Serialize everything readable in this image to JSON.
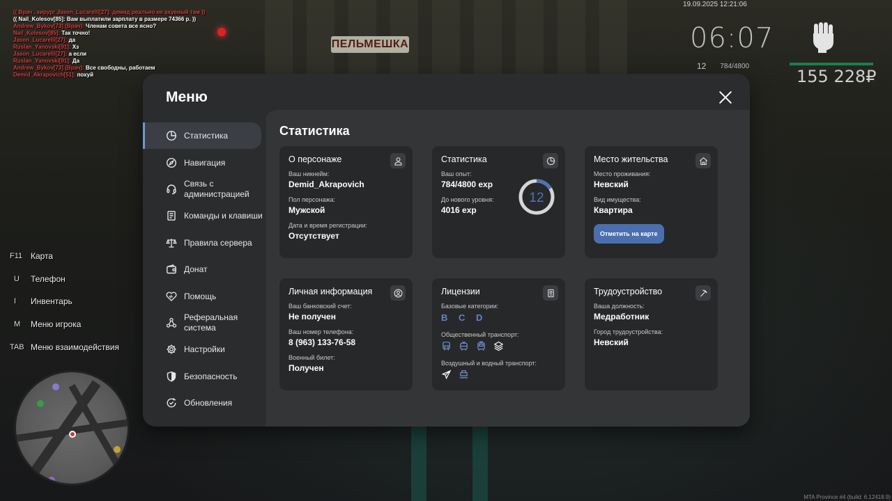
{
  "background": {
    "sign_text": "ПЕЛЬМЕШКА"
  },
  "chat": [
    {
      "text": "(( Врач . хирург Jason_Lucarelli[27]: демид реально не ахуеный там ))",
      "color": "#d93a3a"
    },
    {
      "text": "(( Nail_Kolesov[85]: Вам выплатили зарплату в размере 74366 р. ))",
      "color": "#ffffff"
    },
    {
      "text": "Andrew_Bykov[73] (Врач): Членам совета все ясно?",
      "color": "#ffffff",
      "name_color": "#d93a3a"
    },
    {
      "text": "Nail_Kolesov[85]: Так точно!",
      "color": "#ffffff",
      "name_color": "#d93a3a"
    },
    {
      "text": "Jason_Lucarelli[27]: да",
      "color": "#ffffff",
      "name_color": "#d93a3a"
    },
    {
      "text": "Ruslan_Yanovski[91]: Хз",
      "color": "#ffffff",
      "name_color": "#d93a3a"
    },
    {
      "text": "Jason_Lucarelli[27]: а если",
      "color": "#ffffff",
      "name_color": "#d93a3a"
    },
    {
      "text": "Ruslan_Yanovski[91]: Да",
      "color": "#ffffff",
      "name_color": "#d93a3a"
    },
    {
      "text": "Andrew_Bykov[73] (Врач): Все свободны, работаем",
      "color": "#ffffff",
      "name_color": "#d93a3a"
    },
    {
      "text": "Demid_Akrapovich[51]: похуй",
      "color": "#ffffff",
      "name_color": "#d93a3a"
    }
  ],
  "hud": {
    "datetime": "19.09.2025 12:21:06",
    "time": "06:07",
    "level": "12",
    "exp": "784/4800",
    "money": "155 228₽",
    "bar_color": "#1f7d4c"
  },
  "hotkeys": [
    {
      "key": "F11",
      "label": "Карта"
    },
    {
      "key": "U",
      "label": "Телефон"
    },
    {
      "key": "I",
      "label": "Инвентарь"
    },
    {
      "key": "M",
      "label": "Меню игрока"
    },
    {
      "key": "TAB",
      "label": "Меню взаимодействия"
    }
  ],
  "version": "MTA Province #4 (build: 6.12418.9)",
  "menu": {
    "title": "Меню",
    "sidebar": [
      {
        "label": "Статистика",
        "icon": "pie-chart-icon",
        "active": true
      },
      {
        "label": "Навигация",
        "icon": "compass-icon"
      },
      {
        "label": "Связь с администрацией",
        "icon": "headset-icon"
      },
      {
        "label": "Команды и клавиши",
        "icon": "document-icon"
      },
      {
        "label": "Правила сервера",
        "icon": "scales-icon"
      },
      {
        "label": "Донат",
        "icon": "wallet-icon"
      },
      {
        "label": "Помощь",
        "icon": "handshake-icon"
      },
      {
        "label": "Реферальная система",
        "icon": "network-icon"
      },
      {
        "label": "Настройки",
        "icon": "gear-icon"
      },
      {
        "label": "Безопасность",
        "icon": "shield-icon"
      },
      {
        "label": "Обновления",
        "icon": "refresh-check-icon"
      }
    ],
    "content_title": "Статистика",
    "cards": {
      "character": {
        "title": "О персонаже",
        "nickname_label": "Ваш никнейм:",
        "nickname": "Demid_Akrapovich",
        "gender_label": "Пол персонажа:",
        "gender": "Мужской",
        "reg_label": "Дата и время регистрации:",
        "reg": "Отсутствует"
      },
      "stats": {
        "title": "Статистика",
        "exp_label": "Ваш опыт:",
        "exp": "784/4800 exp",
        "next_label": "До нового уровня:",
        "next": "4016 exp",
        "level": "12",
        "level_progress": 0.163,
        "ring_color": "#4f73b5"
      },
      "residence": {
        "title": "Место жительства",
        "place_label": "Место проживания:",
        "place": "Невский",
        "type_label": "Вид имущества:",
        "type": "Квартира",
        "button": "Отметить на карте"
      },
      "personal": {
        "title": "Личная информация",
        "bank_label": "Ваш банковский счет:",
        "bank": "Не получен",
        "phone_label": "Ваш номер телефона:",
        "phone": "8 (963) 133-76-58",
        "military_label": "Военный билет:",
        "military": "Получен"
      },
      "licenses": {
        "title": "Лицензии",
        "base_label": "Базовые категории:",
        "base": "B C D",
        "public_label": "Общественный транспорт:",
        "air_label": "Воздушный и водный транспорт:"
      },
      "employment": {
        "title": "Трудоустройство",
        "position_label": "Ваша должность:",
        "position": "Медработник",
        "city_label": "Город трудоустройства:",
        "city": "Невский"
      }
    }
  }
}
